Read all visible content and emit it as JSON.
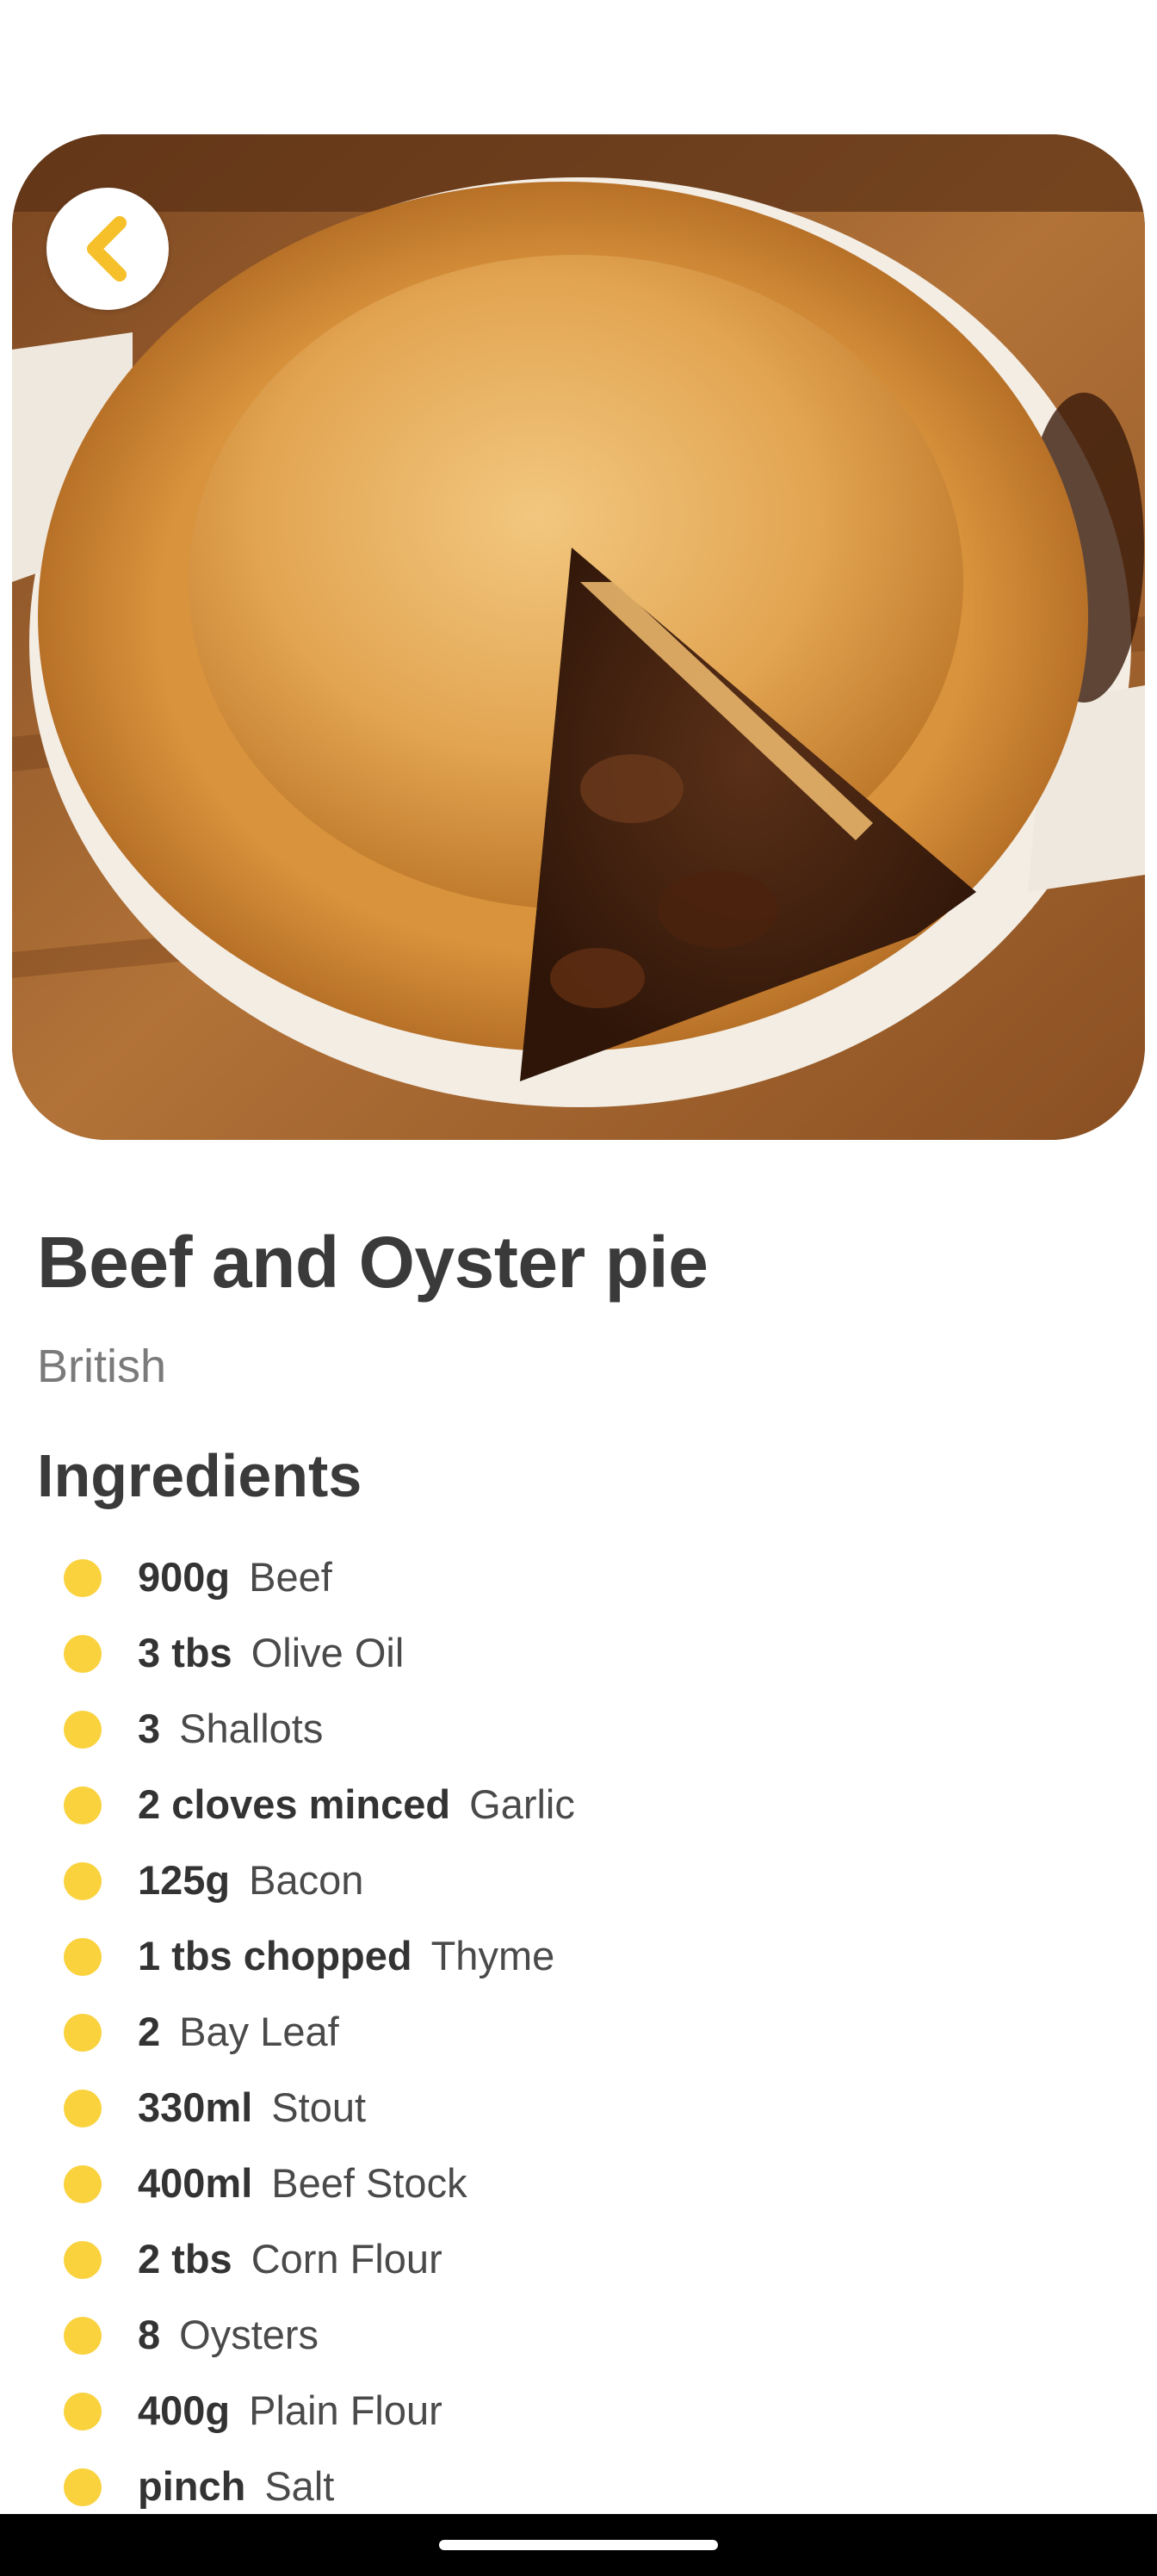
{
  "recipe": {
    "title": "Beef and Oyster pie",
    "cuisine": "British"
  },
  "ingredients_section": {
    "heading": "Ingredients",
    "items": [
      {
        "qty": "900g",
        "name": "Beef"
      },
      {
        "qty": "3 tbs",
        "name": "Olive Oil"
      },
      {
        "qty": "3",
        "name": "Shallots"
      },
      {
        "qty": "2 cloves minced",
        "name": "Garlic"
      },
      {
        "qty": "125g",
        "name": "Bacon"
      },
      {
        "qty": "1 tbs chopped",
        "name": "Thyme"
      },
      {
        "qty": "2",
        "name": "Bay Leaf"
      },
      {
        "qty": "330ml",
        "name": "Stout"
      },
      {
        "qty": "400ml",
        "name": "Beef Stock"
      },
      {
        "qty": "2 tbs",
        "name": "Corn Flour"
      },
      {
        "qty": "8",
        "name": "Oysters"
      },
      {
        "qty": "400g",
        "name": "Plain Flour"
      },
      {
        "qty": "pinch",
        "name": "Salt"
      }
    ]
  },
  "icons": {
    "back": "chevron-left-icon"
  },
  "colors": {
    "accent": "#F9D23E",
    "back_chevron": "#F5C02A",
    "title_text": "#3A3A3A",
    "subtitle_text": "#7A7A7A"
  }
}
